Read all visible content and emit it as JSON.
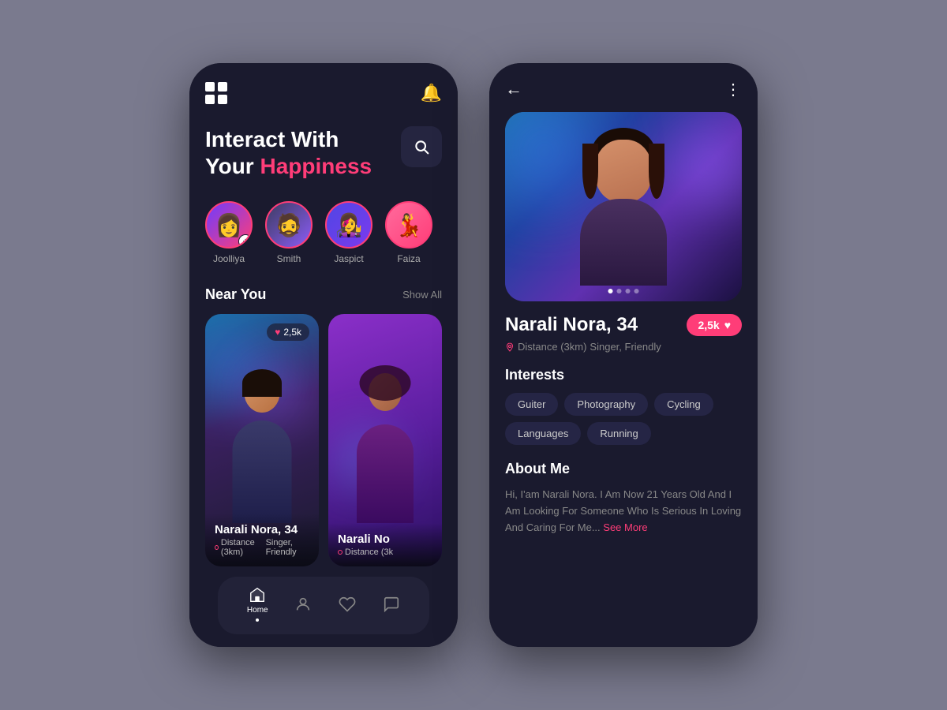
{
  "app": {
    "bg_color": "#7a7a8e"
  },
  "left_phone": {
    "header": {
      "bell_label": "🔔"
    },
    "headline": {
      "line1": "Interact With",
      "line2_white": "Your",
      "line2_pink": "Happiness"
    },
    "search_placeholder": "Search...",
    "stories": [
      {
        "name": "Joolliya",
        "has_add": true
      },
      {
        "name": "Smith",
        "has_add": false
      },
      {
        "name": "Jaspict",
        "has_add": false
      },
      {
        "name": "Faiza",
        "has_add": false
      }
    ],
    "near_you": {
      "title": "Near You",
      "show_all": "Show All"
    },
    "cards": [
      {
        "name": "Narali Nora, 34",
        "distance": "Distance (3km)",
        "tags": "Singer, Friendly",
        "likes": "2,5k"
      },
      {
        "name": "Narali No",
        "distance": "Distance (3k",
        "tags": "",
        "likes": ""
      }
    ],
    "nav": [
      {
        "label": "Home",
        "icon": "⊞",
        "active": true
      },
      {
        "label": "",
        "icon": "👤",
        "active": false
      },
      {
        "label": "",
        "icon": "♡",
        "active": false
      },
      {
        "label": "",
        "icon": "💬",
        "active": false
      }
    ]
  },
  "right_phone": {
    "profile": {
      "name": "Narali Nora, 34",
      "distance": "Distance (3km)",
      "tags": "Singer, Friendly",
      "likes": "2,5k"
    },
    "interests": {
      "title": "Interests",
      "tags": [
        "Guiter",
        "Photography",
        "Cycling",
        "Languages",
        "Running"
      ]
    },
    "about": {
      "title": "About Me",
      "text": "Hi, I'am Narali Nora. I Am Now 21 Years Old And I Am Looking For Someone Who Is Serious In Loving And Caring For Me...",
      "see_more": "See More"
    },
    "photo_dots": [
      true,
      false,
      false,
      false
    ]
  }
}
